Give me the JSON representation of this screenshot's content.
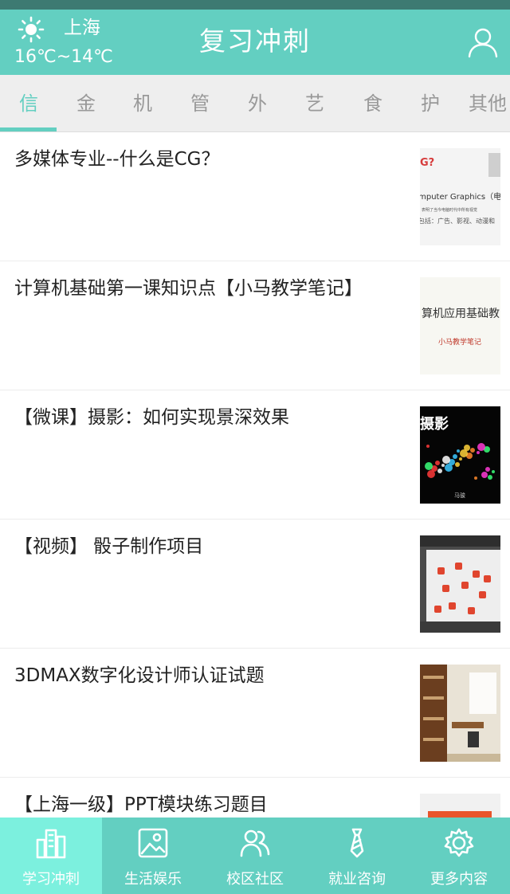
{
  "header": {
    "city": "上海",
    "temperature": "16℃~14℃",
    "title": "复习冲刺",
    "weather_icon": "sun-icon",
    "user_icon": "user-icon"
  },
  "tabs": [
    "信",
    "金",
    "机",
    "管",
    "外",
    "艺",
    "食",
    "护",
    "其他"
  ],
  "active_tab": 0,
  "articles": [
    {
      "title": "多媒体专业--什么是CG？",
      "thumb": {
        "lines": [
          "G?",
          "omputer Graphics（电",
          "品，表明了当今电脑时代中所有视觉",
          "包括：广告、影视、动漫和"
        ]
      }
    },
    {
      "title": "计算机基础第一课知识点【小马教学笔记】",
      "thumb": {
        "heading": "算机应用基础教",
        "caption": "小马教学笔记"
      }
    },
    {
      "title": "【微课】摄影：如何实现景深效果",
      "thumb": {
        "heading": "摄影",
        "caption": "马骏"
      }
    },
    {
      "title": "【视频】 骰子制作项目",
      "thumb": {}
    },
    {
      "title": "3DMAX数字化设计师认证试题",
      "thumb": {}
    },
    {
      "title": "【上海一级】PPT模块练习题目",
      "thumb": {}
    }
  ],
  "bottom_nav": [
    {
      "label": "学习冲刺",
      "icon": "buildings-icon"
    },
    {
      "label": "生活娱乐",
      "icon": "picture-icon"
    },
    {
      "label": "校区社区",
      "icon": "people-icon"
    },
    {
      "label": "就业咨询",
      "icon": "tie-icon"
    },
    {
      "label": "更多内容",
      "icon": "gear-icon"
    }
  ],
  "active_nav": 0,
  "colors": {
    "primary": "#63cfc1",
    "active_nav_bg": "#7cf0de",
    "status_bar": "#3d7a72",
    "tab_bar_bg": "#eeeeee",
    "tab_inactive": "#999999",
    "title_text": "#222222",
    "cg_thumb_accent": "#d63b3b",
    "dice_red": "#e0452e"
  }
}
